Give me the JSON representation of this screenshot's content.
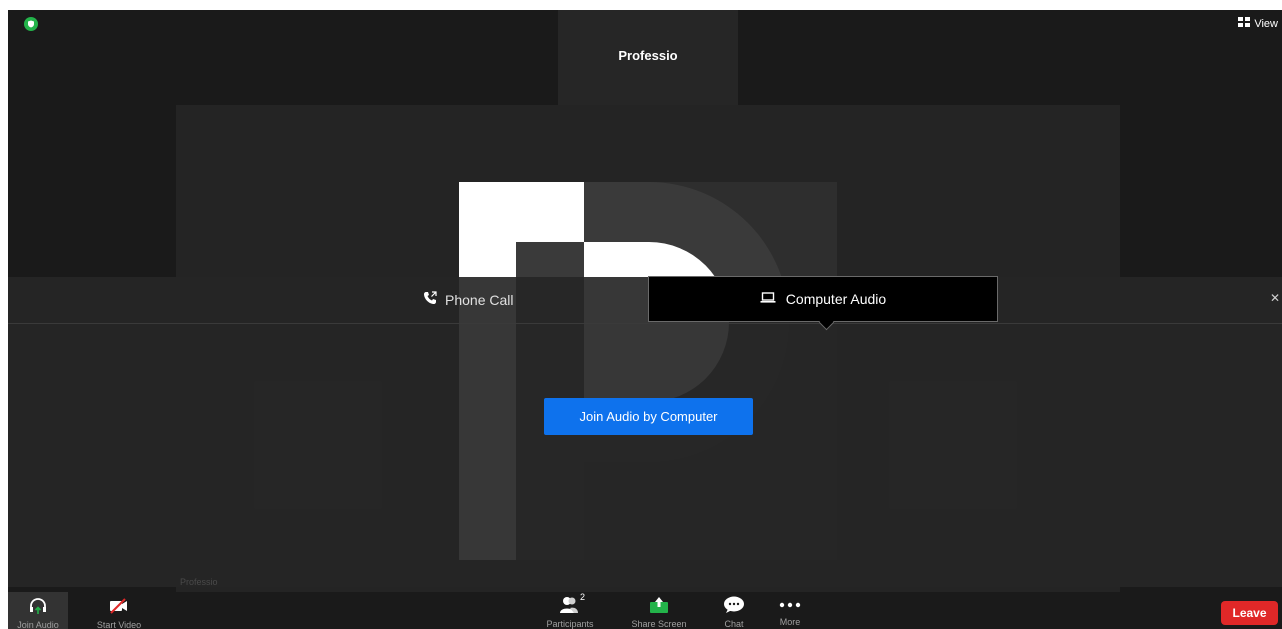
{
  "meeting": {
    "speaker_name": "Professio",
    "tile_name": "Professio",
    "view_label": "View"
  },
  "audio_dialog": {
    "tabs": [
      {
        "label": "Phone Call",
        "icon": "phone-icon",
        "active": false
      },
      {
        "label": "Computer Audio",
        "icon": "laptop-icon",
        "active": true
      }
    ],
    "join_button": "Join Audio by Computer"
  },
  "toolbar": {
    "join_audio": "Join Audio",
    "start_video": "Start Video",
    "participants": "Participants",
    "participants_count": "2",
    "share_screen": "Share Screen",
    "chat": "Chat",
    "more": "More",
    "leave": "Leave"
  },
  "colors": {
    "accent_blue": "#0e72ed",
    "leave_red": "#e02828",
    "share_green": "#23b34a",
    "background": "#1a1a1a"
  }
}
